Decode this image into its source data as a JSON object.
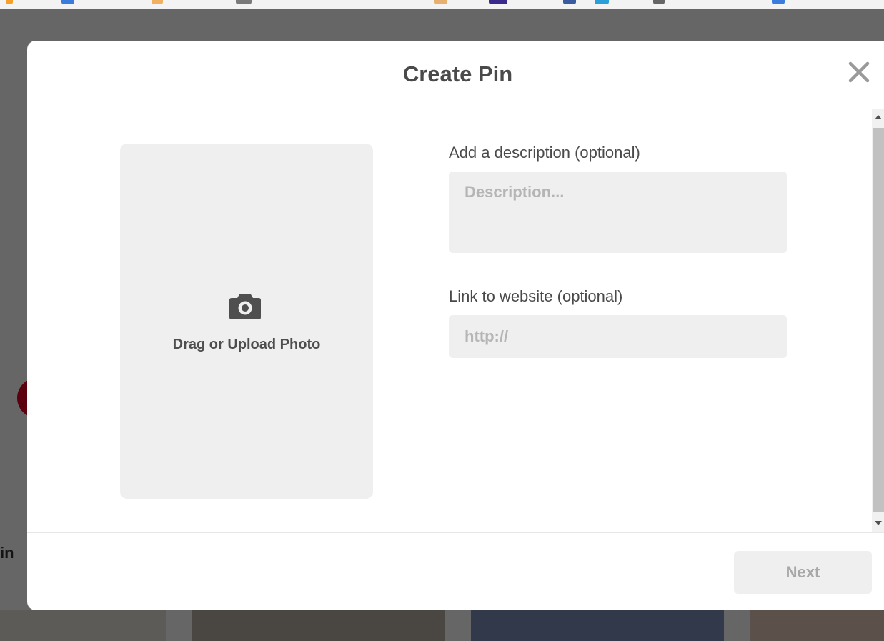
{
  "modal": {
    "title": "Create Pin",
    "upload": {
      "label": "Drag or Upload Photo",
      "icon": "camera-icon"
    },
    "description": {
      "label": "Add a description (optional)",
      "placeholder": "Description...",
      "value": ""
    },
    "link": {
      "label": "Link to website (optional)",
      "placeholder": "http://",
      "value": ""
    },
    "next_label": "Next",
    "close_icon": "close-icon"
  },
  "background": {
    "side_text": "in"
  },
  "colors": {
    "overlay": "#000000",
    "field_background": "#efefef",
    "title_text": "#4a4a4a",
    "disabled_button_text": "#a8a8a8"
  }
}
